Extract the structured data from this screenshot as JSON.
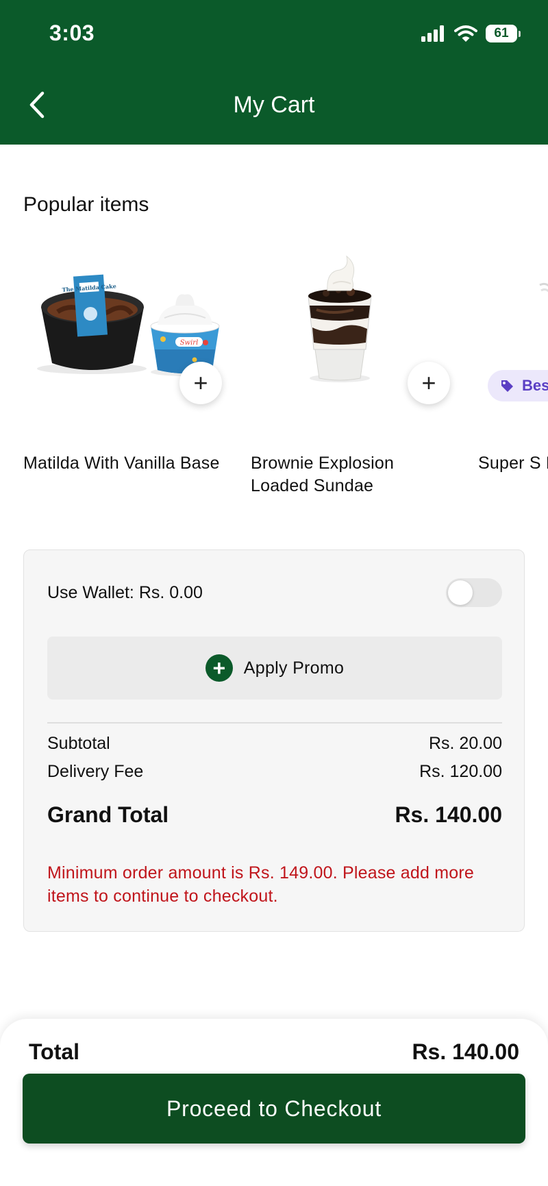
{
  "status_bar": {
    "time": "3:03",
    "battery": "61"
  },
  "header": {
    "title": "My Cart"
  },
  "popular": {
    "title": "Popular items",
    "items": [
      {
        "name": "Matilda With Vanilla Base",
        "cake_label": "The Matilda Cake",
        "cup_label": "Swirl"
      },
      {
        "name": "Brownie Explosion Loaded Sundae"
      },
      {
        "name": "Super S Fudge L",
        "badge": "Bes"
      }
    ]
  },
  "summary": {
    "wallet_label": "Use Wallet: Rs. 0.00",
    "promo_label": "Apply Promo",
    "subtotal_label": "Subtotal",
    "subtotal_value": "Rs. 20.00",
    "delivery_label": "Delivery Fee",
    "delivery_value": "Rs. 120.00",
    "grand_label": "Grand Total",
    "grand_value": "Rs. 140.00",
    "warning": "Minimum order amount is Rs. 149.00. Please add more items to continue to checkout."
  },
  "footer": {
    "total_label": "Total",
    "total_value": "Rs. 140.00",
    "checkout_label": "Proceed to Checkout"
  },
  "colors": {
    "brand": "#0b5a2a",
    "button": "#0d4d21",
    "warning": "#c0151b",
    "badge": "#5b3fc4"
  },
  "icons": [
    "back-chevron-icon",
    "signal-icon",
    "wifi-icon",
    "battery-icon",
    "plus-icon",
    "tag-icon"
  ]
}
